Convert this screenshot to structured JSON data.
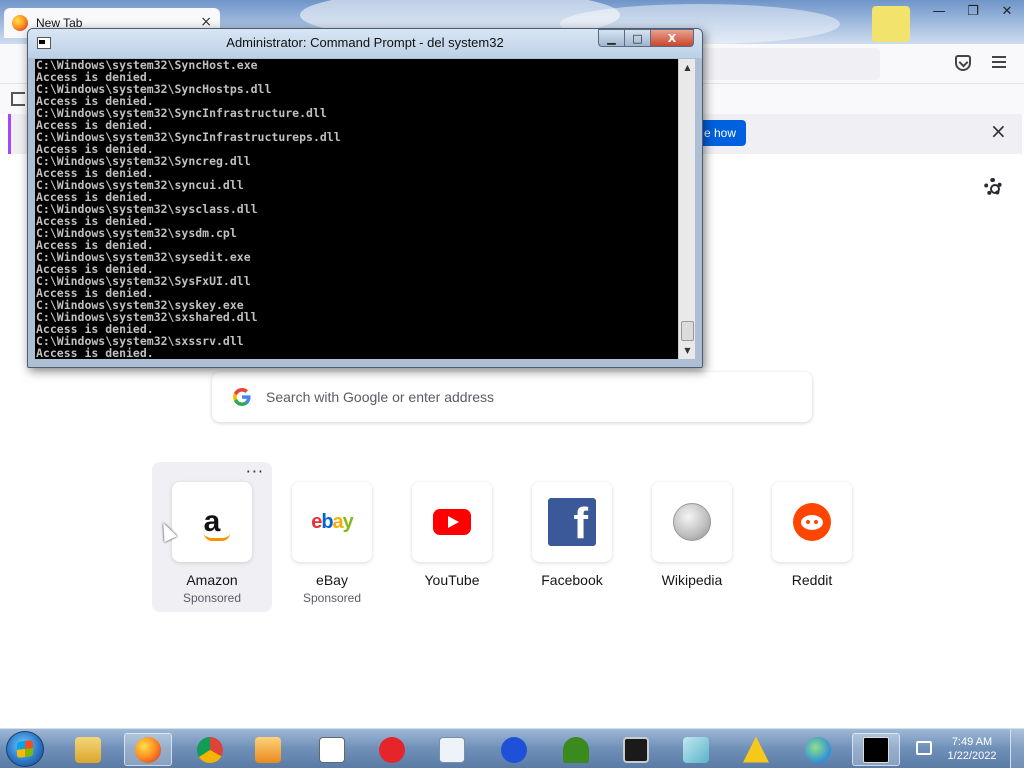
{
  "browser": {
    "tab_title": "New Tab",
    "tab_close": "×",
    "window_controls": {
      "minimize": "—",
      "restore": "❐",
      "close": "✕"
    },
    "notification_button": "e how",
    "notification_close": "×"
  },
  "newtab": {
    "search_placeholder": "Search with Google or enter address",
    "more_menu": "···",
    "top_sites": [
      {
        "label": "Amazon",
        "sub": "Sponsored",
        "icon": "amazon-icon"
      },
      {
        "label": "eBay",
        "sub": "Sponsored",
        "icon": "ebay-icon"
      },
      {
        "label": "YouTube",
        "sub": "",
        "icon": "youtube-icon"
      },
      {
        "label": "Facebook",
        "sub": "",
        "icon": "facebook-icon"
      },
      {
        "label": "Wikipedia",
        "sub": "",
        "icon": "wikipedia-icon"
      },
      {
        "label": "Reddit",
        "sub": "",
        "icon": "reddit-icon"
      }
    ],
    "logos": {
      "amazon": "a",
      "facebook": "f",
      "ebay": [
        "e",
        "b",
        "a",
        "y"
      ]
    }
  },
  "cmd": {
    "title": "Administrator: Command Prompt - del  system32",
    "controls": {
      "minimize": "▁",
      "maximize": "□",
      "close": "X"
    },
    "lines": [
      "C:\\Windows\\system32\\SyncHost.exe",
      "Access is denied.",
      "C:\\Windows\\system32\\SyncHostps.dll",
      "Access is denied.",
      "C:\\Windows\\system32\\SyncInfrastructure.dll",
      "Access is denied.",
      "C:\\Windows\\system32\\SyncInfrastructureps.dll",
      "Access is denied.",
      "C:\\Windows\\system32\\Syncreg.dll",
      "Access is denied.",
      "C:\\Windows\\system32\\syncui.dll",
      "Access is denied.",
      "C:\\Windows\\system32\\sysclass.dll",
      "Access is denied.",
      "C:\\Windows\\system32\\sysdm.cpl",
      "Access is denied.",
      "C:\\Windows\\system32\\sysedit.exe",
      "Access is denied.",
      "C:\\Windows\\system32\\SysFxUI.dll",
      "Access is denied.",
      "C:\\Windows\\system32\\syskey.exe",
      "C:\\Windows\\system32\\sxshared.dll",
      "Access is denied.",
      "C:\\Windows\\system32\\sxssrv.dll",
      "Access is denied."
    ]
  },
  "taskbar": {
    "time": "7:49 AM",
    "date": "1/22/2022",
    "items": [
      "windows-explorer-icon",
      "firefox-icon",
      "chrome-icon",
      "media-player-icon",
      "notepad-icon",
      "error-icon",
      "folder-icon",
      "plus-icon",
      "tree-icon",
      "monitor-icon",
      "tablet-icon",
      "warning-icon",
      "globe-icon",
      "command-prompt-icon"
    ]
  }
}
